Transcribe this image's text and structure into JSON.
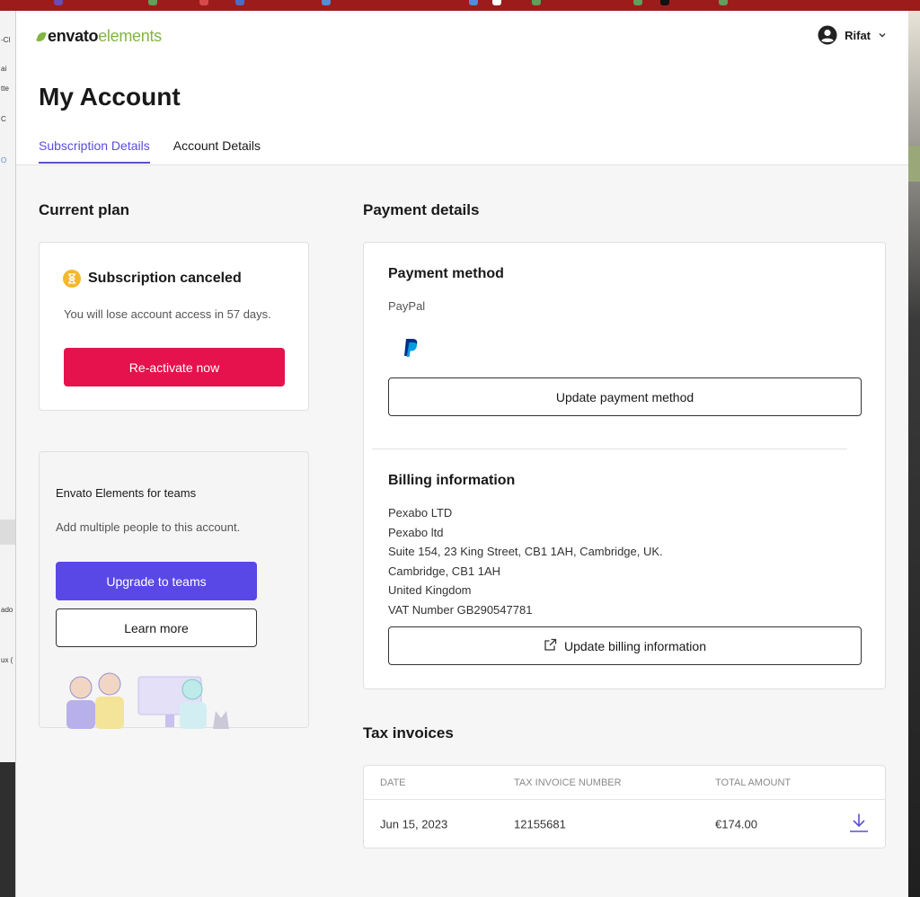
{
  "header": {
    "logo_primary": "envato",
    "logo_secondary": "elements",
    "user_name": "Rifat"
  },
  "page": {
    "title": "My Account",
    "tabs": [
      {
        "label": "Subscription Details",
        "active": true
      },
      {
        "label": "Account Details",
        "active": false
      }
    ]
  },
  "current_plan": {
    "section_title": "Current plan",
    "status_title": "Subscription canceled",
    "status_message": "You will lose account access in 57 days.",
    "reactivate_label": "Re-activate now"
  },
  "teams": {
    "title": "Envato Elements for teams",
    "message": "Add multiple people to this account.",
    "upgrade_label": "Upgrade to teams",
    "learn_more_label": "Learn more"
  },
  "payment": {
    "section_title": "Payment details",
    "method_title": "Payment method",
    "method_name": "PayPal",
    "update_method_label": "Update payment method",
    "billing_title": "Billing information",
    "billing_lines": [
      "Pexabo LTD",
      "Pexabo ltd",
      "Suite 154, 23 King Street, CB1 1AH, Cambridge, UK.",
      "Cambridge, CB1 1AH",
      "United Kingdom",
      "VAT Number GB290547781"
    ],
    "update_billing_label": "Update billing information"
  },
  "tax_invoices": {
    "section_title": "Tax invoices",
    "columns": [
      "DATE",
      "TAX INVOICE NUMBER",
      "TOTAL AMOUNT"
    ],
    "rows": [
      {
        "date": "Jun 15, 2023",
        "number": "12155681",
        "amount": "€174.00"
      }
    ]
  },
  "background": {
    "left_fragments": [
      "-Cl",
      "ai",
      "tte",
      "C",
      "O",
      "ado",
      "ux ("
    ]
  },
  "colors": {
    "accent": "#5a4ed6",
    "brand_green": "#82b541",
    "danger": "#e6124d",
    "purple_button": "#5948e6",
    "warning": "#f5b72c"
  }
}
